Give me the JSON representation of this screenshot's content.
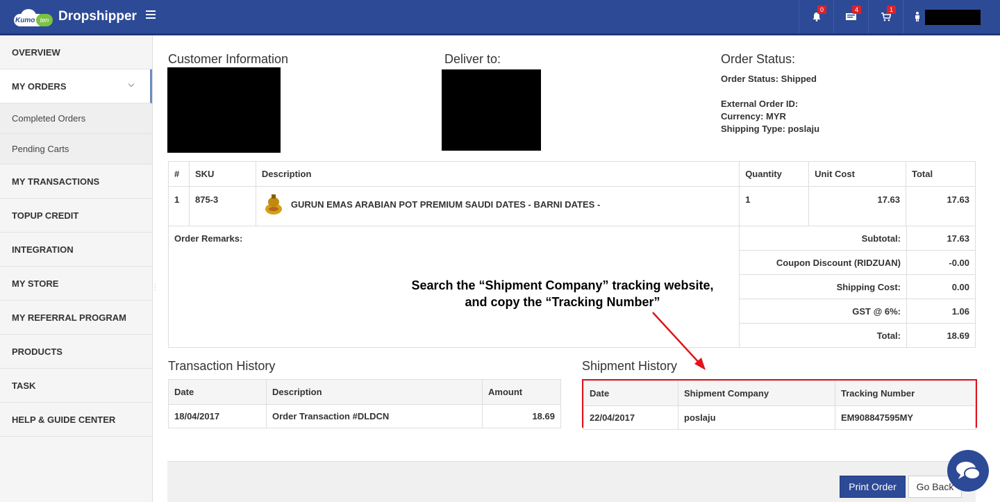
{
  "header": {
    "brand": "Dropshipper",
    "logo_kumo": "Kumo",
    "logo_ten": "ten",
    "notifications_count": "0",
    "messages_count": "4",
    "cart_count": "1"
  },
  "sidebar": {
    "items": [
      {
        "label": "OVERVIEW"
      },
      {
        "label": "MY ORDERS"
      },
      {
        "label": "Completed Orders"
      },
      {
        "label": "Pending Carts"
      },
      {
        "label": "MY TRANSACTIONS"
      },
      {
        "label": "TOPUP CREDIT"
      },
      {
        "label": "INTEGRATION"
      },
      {
        "label": "MY STORE"
      },
      {
        "label": "MY REFERRAL PROGRAM"
      },
      {
        "label": "PRODUCTS"
      },
      {
        "label": "TASK"
      },
      {
        "label": "HELP & GUIDE CENTER"
      }
    ]
  },
  "customer": {
    "heading": "Customer Information"
  },
  "deliver": {
    "heading": "Deliver to:"
  },
  "order_status": {
    "heading": "Order Status:",
    "status": "Order Status: Shipped",
    "external_id": "External Order ID:",
    "currency": "Currency: MYR",
    "shipping_type": "Shipping Type: poslaju"
  },
  "items_table": {
    "headers": [
      "#",
      "SKU",
      "Description",
      "Quantity",
      "Unit Cost",
      "Total"
    ],
    "rows": [
      {
        "num": "1",
        "sku": "875-3",
        "description": "GURUN EMAS ARABIAN POT PREMIUM SAUDI DATES - BARNI DATES -",
        "quantity": "1",
        "unit_cost": "17.63",
        "total": "17.63"
      }
    ],
    "remarks_label": "Order Remarks:"
  },
  "summary": {
    "subtotal_label": "Subtotal:",
    "subtotal": "17.63",
    "coupon_label": "Coupon Discount (RIDZUAN)",
    "coupon": "-0.00",
    "shipping_label": "Shipping Cost:",
    "shipping": "0.00",
    "gst_label": "GST @ 6%:",
    "gst": "1.06",
    "total_label": "Total:",
    "total": "18.69"
  },
  "annotation": {
    "line1": "Search the “Shipment Company” tracking website,",
    "line2": "and copy the “Tracking Number”",
    "highlight_color": "#e0141b"
  },
  "transaction_history": {
    "heading": "Transaction History",
    "headers": [
      "Date",
      "Description",
      "Amount"
    ],
    "row": {
      "date": "18/04/2017",
      "description": "Order Transaction #DLDCN",
      "amount": "18.69"
    }
  },
  "shipment_history": {
    "heading": "Shipment History",
    "headers": [
      "Date",
      "Shipment Company",
      "Tracking Number"
    ],
    "row": {
      "date": "22/04/2017",
      "company": "poslaju",
      "tracking": "EM908847595MY"
    }
  },
  "actions": {
    "print": "Print Order",
    "back": "Go Back"
  },
  "colors": {
    "nav": "#2d4a96",
    "badge": "#d9232d"
  }
}
